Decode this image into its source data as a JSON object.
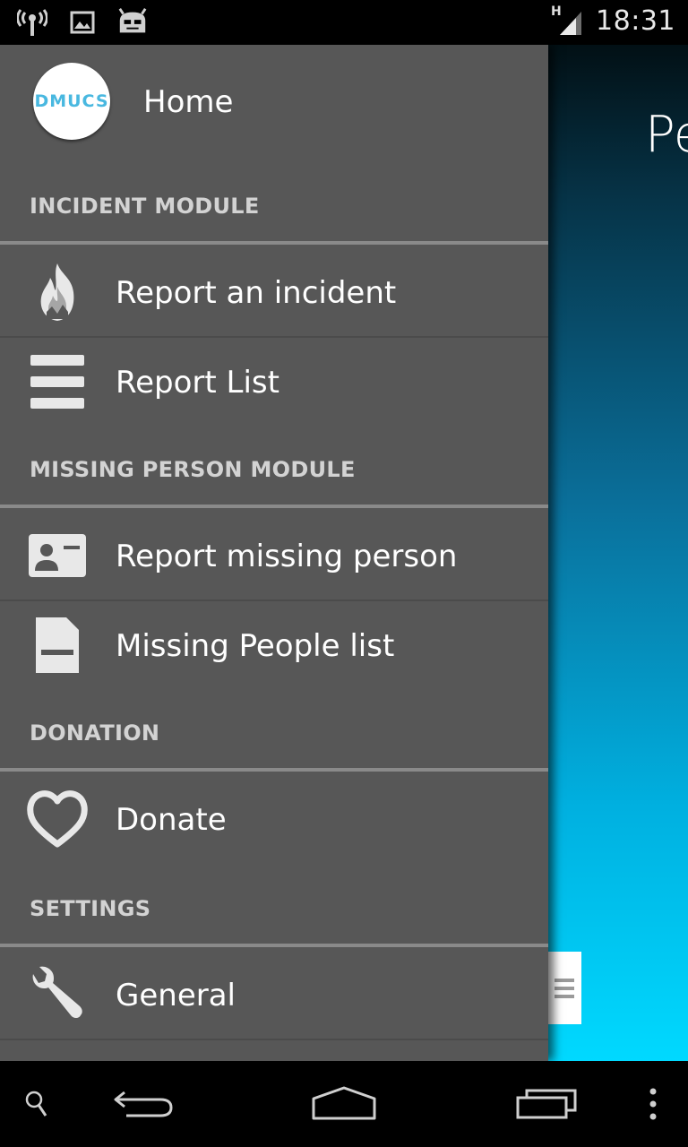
{
  "status_bar": {
    "time": "18:31",
    "network_label": "H",
    "icons": [
      "wireless-tower-icon",
      "image-icon",
      "android-icon",
      "signal-icon"
    ]
  },
  "main_content": {
    "title_partial": "Pe"
  },
  "drawer": {
    "home": {
      "logo_text": "DMUCS",
      "label": "Home"
    },
    "sections": [
      {
        "header": "INCIDENT MODULE",
        "items": [
          {
            "label": "Report an incident",
            "icon": "fire-icon"
          },
          {
            "label": "Report List",
            "icon": "list-icon"
          }
        ]
      },
      {
        "header": "MISSING PERSON MODULE",
        "items": [
          {
            "label": "Report missing person",
            "icon": "id-card-icon"
          },
          {
            "label": "Missing People list",
            "icon": "document-icon"
          }
        ]
      },
      {
        "header": "DONATION",
        "items": [
          {
            "label": "Donate",
            "icon": "heart-icon"
          }
        ]
      },
      {
        "header": "SETTINGS",
        "items": [
          {
            "label": "General",
            "icon": "wrench-icon"
          }
        ]
      }
    ]
  },
  "nav_bar": {
    "buttons": [
      "search-icon",
      "back-icon",
      "home-icon",
      "recents-icon",
      "overflow-menu-icon"
    ]
  },
  "colors": {
    "drawer_bg": "#575757",
    "section_text": "#d3d3d3",
    "accent": "#49b8e0",
    "main_gradient_bottom": "#00d9ff"
  }
}
